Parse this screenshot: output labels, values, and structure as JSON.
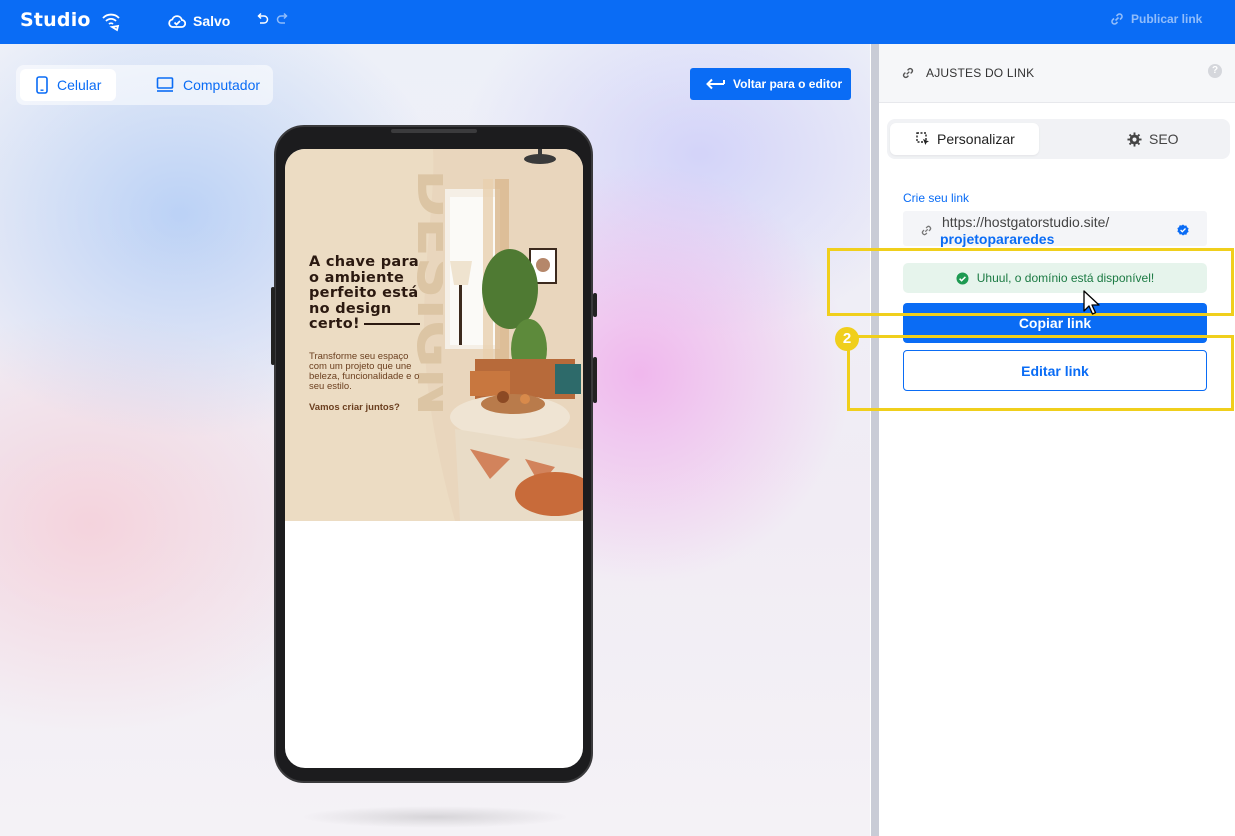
{
  "topbar": {
    "brand": "Studio",
    "status_label": "Salvo",
    "publish_label": "Publicar link",
    "background_color": "#0a6cf5"
  },
  "canvas": {
    "device_switch": {
      "mobile_label": "Celular",
      "desktop_label": "Computador",
      "selected": "Celular"
    },
    "back_button_label": "Voltar para o editor"
  },
  "preview": {
    "headline": "A chave para o ambiente perfeito está no design certo!",
    "subtext": "Transforme seu espaço com um projeto que une beleza, funcionalidade e o seu estilo.",
    "cta": "Vamos criar juntos?",
    "vertical_word": "DESIGN"
  },
  "panel": {
    "title": "AJUSTES DO LINK",
    "help": "?",
    "tabs": [
      {
        "label": "Personalizar",
        "icon": "cursor-select-icon",
        "active": true
      },
      {
        "label": "SEO",
        "icon": "gear-icon",
        "active": false
      }
    ],
    "link_label": "Crie seu link",
    "url_base": "https://hostgatorstudio.site/",
    "url_slug": "projetopararedes",
    "availability_message": "Uhuul, o domínio está disponível!",
    "copy_button_label": "Copiar link",
    "edit_button_label": "Editar link"
  },
  "annotation": {
    "step_number": "2",
    "highlight_color": "#f0cf1c"
  }
}
